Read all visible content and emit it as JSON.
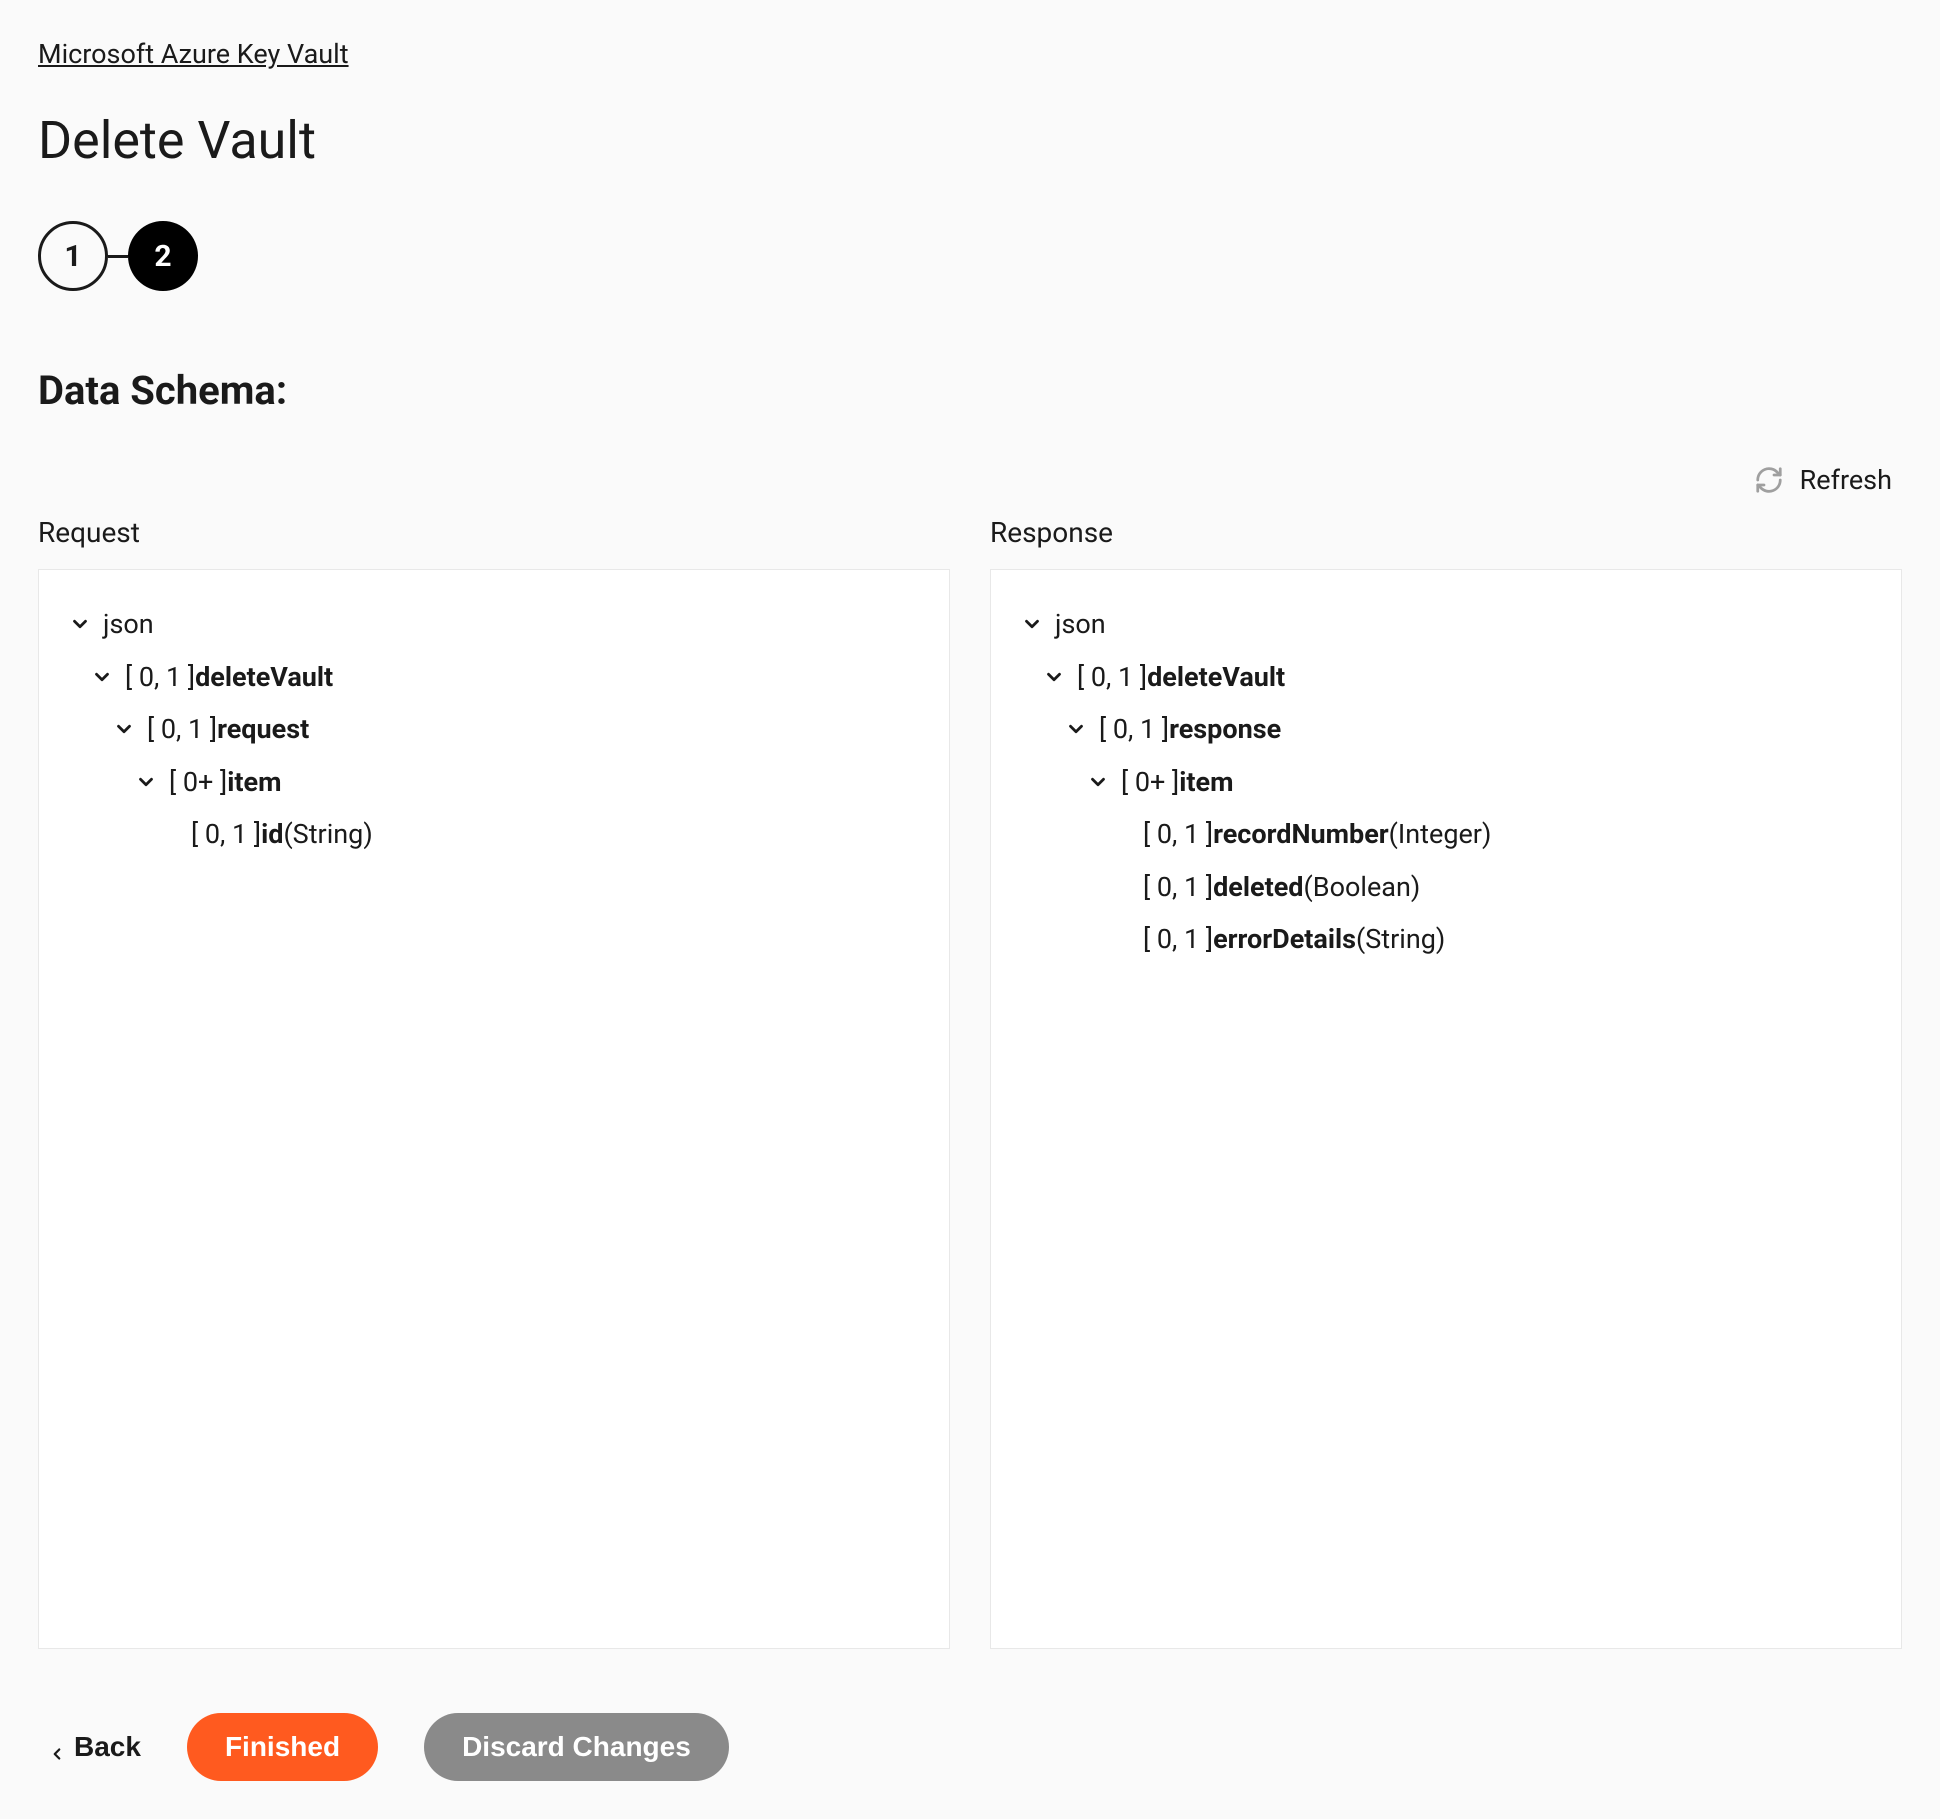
{
  "breadcrumb": {
    "label": "Microsoft Azure Key Vault"
  },
  "page": {
    "title": "Delete Vault",
    "section_title": "Data Schema:"
  },
  "stepper": {
    "step1": "1",
    "step2": "2"
  },
  "refresh": {
    "label": "Refresh"
  },
  "columns": {
    "request_heading": "Request",
    "response_heading": "Response"
  },
  "request_tree": {
    "root": "json",
    "n1_card": "[ 0, 1 ] ",
    "n1_name": "deleteVault",
    "n2_card": "[ 0, 1 ] ",
    "n2_name": "request",
    "n3_card": "[ 0+ ] ",
    "n3_name": "item",
    "n4_card": "[ 0, 1 ] ",
    "n4_name": "id",
    "n4_type": " (String)"
  },
  "response_tree": {
    "root": "json",
    "n1_card": "[ 0, 1 ] ",
    "n1_name": "deleteVault",
    "n2_card": "[ 0, 1 ] ",
    "n2_name": "response",
    "n3_card": "[ 0+ ] ",
    "n3_name": "item",
    "n4_card": "[ 0, 1 ] ",
    "n4_name": "recordNumber",
    "n4_type": " (Integer)",
    "n5_card": "[ 0, 1 ] ",
    "n5_name": "deleted",
    "n5_type": " (Boolean)",
    "n6_card": "[ 0, 1 ] ",
    "n6_name": "errorDetails",
    "n6_type": " (String)"
  },
  "footer": {
    "back": "Back",
    "finished": "Finished",
    "discard": "Discard Changes"
  }
}
